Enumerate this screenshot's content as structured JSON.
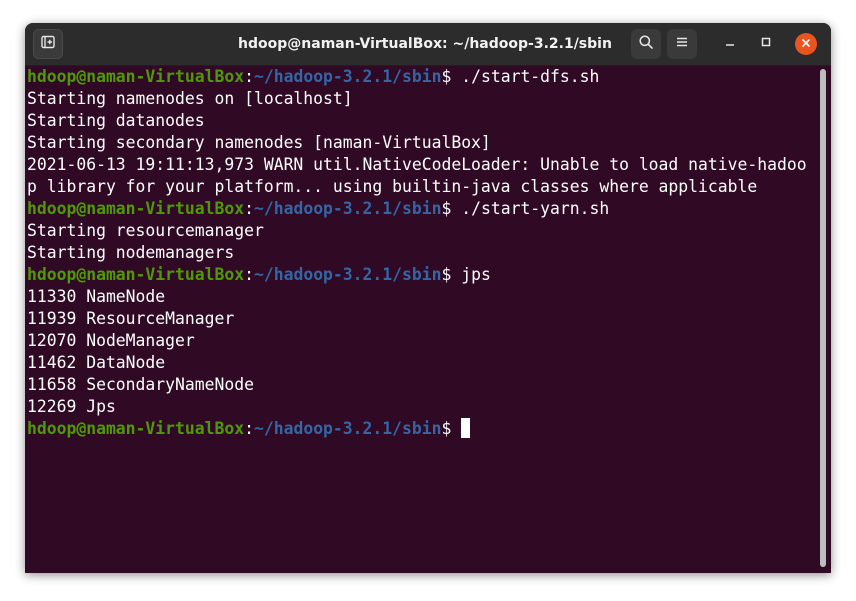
{
  "window": {
    "title": "hdoop@naman-VirtualBox: ~/hadoop-3.2.1/sbin"
  },
  "icons": {
    "new_tab": "new-tab-icon",
    "search": "search-icon",
    "menu": "hamburger-menu-icon",
    "minimize": "minimize-icon",
    "maximize": "maximize-icon",
    "close": "close-icon"
  },
  "colors": {
    "terminal_bg": "#300a24",
    "prompt_user": "#4e9a06",
    "prompt_path": "#3465a4",
    "close_button": "#e95420"
  },
  "prompt": {
    "user_host": "hdoop@naman-VirtualBox",
    "colon": ":",
    "path": "~/hadoop-3.2.1/sbin",
    "symbol": "$ "
  },
  "terminal": {
    "lines": [
      {
        "type": "prompt",
        "command": "./start-dfs.sh"
      },
      {
        "type": "output",
        "text": "Starting namenodes on [localhost]"
      },
      {
        "type": "output",
        "text": "Starting datanodes"
      },
      {
        "type": "output",
        "text": "Starting secondary namenodes [naman-VirtualBox]"
      },
      {
        "type": "output",
        "text": "2021-06-13 19:11:13,973 WARN util.NativeCodeLoader: Unable to load native-hadoo"
      },
      {
        "type": "output",
        "text": "p library for your platform... using builtin-java classes where applicable"
      },
      {
        "type": "prompt",
        "command": "./start-yarn.sh"
      },
      {
        "type": "output",
        "text": "Starting resourcemanager"
      },
      {
        "type": "output",
        "text": "Starting nodemanagers"
      },
      {
        "type": "prompt",
        "command": "jps"
      },
      {
        "type": "output",
        "text": "11330 NameNode"
      },
      {
        "type": "output",
        "text": "11939 ResourceManager"
      },
      {
        "type": "output",
        "text": "12070 NodeManager"
      },
      {
        "type": "output",
        "text": "11462 DataNode"
      },
      {
        "type": "output",
        "text": "11658 SecondaryNameNode"
      },
      {
        "type": "output",
        "text": "12269 Jps"
      },
      {
        "type": "prompt",
        "command": "",
        "cursor": true
      }
    ]
  }
}
